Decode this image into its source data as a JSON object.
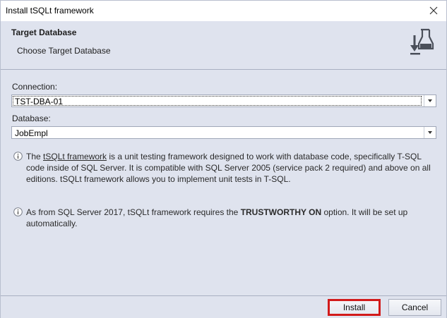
{
  "window": {
    "title": "Install tSQLt framework"
  },
  "header": {
    "title": "Target Database",
    "subtitle": "Choose Target Database"
  },
  "connection": {
    "label": "Connection:",
    "value": "TST-DBA-01"
  },
  "database": {
    "label": "Database:",
    "value": "JobEmpl"
  },
  "info1": {
    "prefix": "The ",
    "link": "tSQLt framework",
    "text": " is a unit testing framework designed to work with database code, specifically T-SQL code inside of SQL Server. It is compatible with SQL Server 2005 (service pack 2 required) and above on all editions. tSQLt framework allows you to implement unit tests in T-SQL."
  },
  "info2": {
    "prefix": "As from SQL Server 2017, tSQLt framework requires the ",
    "bold": "TRUSTWORTHY ON",
    "suffix": " option. It will be set up automatically."
  },
  "buttons": {
    "install": "Install",
    "cancel": "Cancel"
  },
  "colors": {
    "background": "#dfe3ee",
    "highlight": "#d21a1a"
  },
  "icons": {
    "close": "close-icon",
    "header": "flask-install-icon",
    "info": "info-icon"
  }
}
